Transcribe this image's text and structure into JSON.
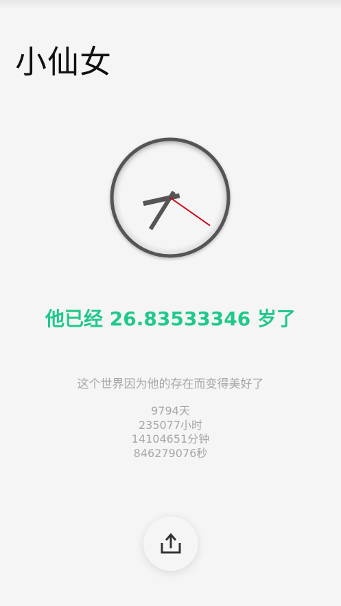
{
  "header": {
    "title": "小仙女"
  },
  "clock": {
    "hour": 8,
    "minute": 35,
    "second": 20,
    "hands_color": "#555555",
    "second_hand_color": "#d0021b",
    "rim_color": "#555555"
  },
  "age": {
    "prefix": "他已经",
    "value": "26.83533346",
    "suffix": "岁了",
    "color": "#1fc98a"
  },
  "tagline": "这个世界因为他的存在而变得美好了",
  "stats": [
    {
      "value": "9794",
      "unit": "天"
    },
    {
      "value": "235077",
      "unit": "小时"
    },
    {
      "value": "14104651",
      "unit": "分钟"
    },
    {
      "value": "846279076",
      "unit": "秒"
    }
  ],
  "share": {
    "icon": "share-icon"
  }
}
